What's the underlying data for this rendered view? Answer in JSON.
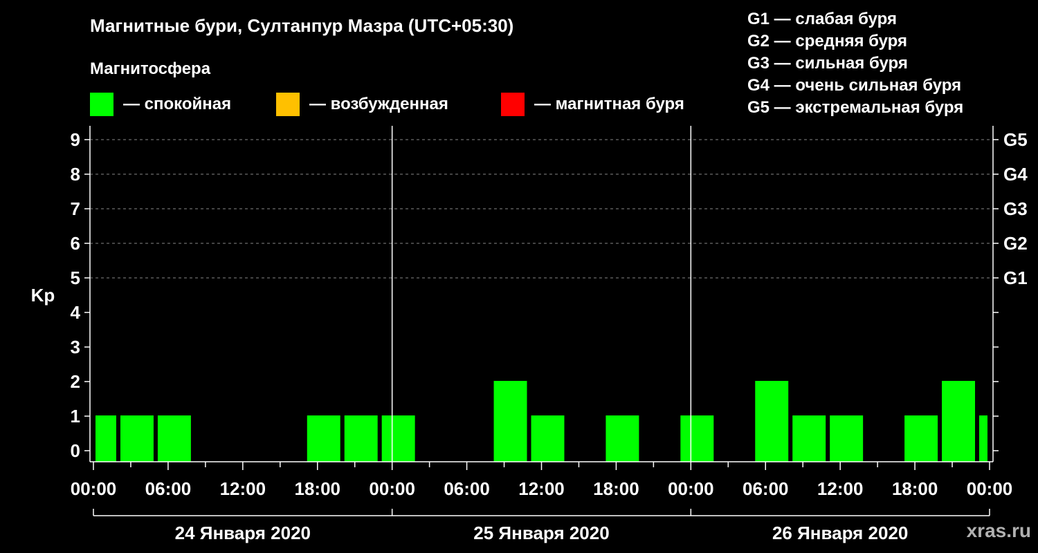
{
  "header": {
    "title": "Магнитные бури, Султанпур Мазра (UTC+05:30)",
    "magnetosphere_label": "Магнитосфера"
  },
  "legend": [
    {
      "label": "— спокойная",
      "color": "#00ff00"
    },
    {
      "label": "— возбужденная",
      "color": "#ffc000"
    },
    {
      "label": "— магнитная буря",
      "color": "#ff0000"
    }
  ],
  "g_scale": [
    "G1 — слабая буря",
    "G2 — средняя буря",
    "G3 — сильная буря",
    "G4 — очень сильная буря",
    "G5 — экстремальная буря"
  ],
  "credit": "xras.ru",
  "chart_data": {
    "type": "bar",
    "ylabel": "Kp",
    "ylim": [
      0,
      9
    ],
    "y_ticks": [
      "0",
      "1",
      "2",
      "3",
      "4",
      "5",
      "6",
      "7",
      "8",
      "9"
    ],
    "g_levels": [
      {
        "label": "G1",
        "kp": 5
      },
      {
        "label": "G2",
        "kp": 6
      },
      {
        "label": "G3",
        "kp": 7
      },
      {
        "label": "G4",
        "kp": 8
      },
      {
        "label": "G5",
        "kp": 9
      }
    ],
    "x_ticks": [
      "00:00",
      "06:00",
      "12:00",
      "18:00",
      "00:00",
      "06:00",
      "12:00",
      "18:00",
      "00:00",
      "06:00",
      "12:00",
      "18:00",
      "00:00"
    ],
    "days": [
      "24 Января 2020",
      "25 Января 2020",
      "26 Января 2020"
    ],
    "x_range_hours": [
      0,
      72
    ],
    "grid": "dashed horizontal at G levels",
    "bar_color": "#00ff00",
    "bars": [
      {
        "start_hour": 0,
        "end_hour": 2,
        "kp": 1
      },
      {
        "start_hour": 2,
        "end_hour": 5,
        "kp": 1
      },
      {
        "start_hour": 5,
        "end_hour": 8,
        "kp": 1
      },
      {
        "start_hour": 8,
        "end_hour": 11,
        "kp": 0
      },
      {
        "start_hour": 11,
        "end_hour": 14,
        "kp": 0
      },
      {
        "start_hour": 14,
        "end_hour": 17,
        "kp": 0
      },
      {
        "start_hour": 17,
        "end_hour": 20,
        "kp": 1
      },
      {
        "start_hour": 20,
        "end_hour": 23,
        "kp": 1
      },
      {
        "start_hour": 23,
        "end_hour": 26,
        "kp": 1
      },
      {
        "start_hour": 26,
        "end_hour": 29,
        "kp": 0
      },
      {
        "start_hour": 29,
        "end_hour": 32,
        "kp": 0
      },
      {
        "start_hour": 32,
        "end_hour": 35,
        "kp": 2
      },
      {
        "start_hour": 35,
        "end_hour": 38,
        "kp": 1
      },
      {
        "start_hour": 38,
        "end_hour": 41,
        "kp": 0
      },
      {
        "start_hour": 41,
        "end_hour": 44,
        "kp": 1
      },
      {
        "start_hour": 44,
        "end_hour": 47,
        "kp": 0
      },
      {
        "start_hour": 47,
        "end_hour": 50,
        "kp": 1
      },
      {
        "start_hour": 50,
        "end_hour": 53,
        "kp": 0
      },
      {
        "start_hour": 53,
        "end_hour": 56,
        "kp": 2
      },
      {
        "start_hour": 56,
        "end_hour": 59,
        "kp": 1
      },
      {
        "start_hour": 59,
        "end_hour": 62,
        "kp": 1
      },
      {
        "start_hour": 62,
        "end_hour": 65,
        "kp": 0
      },
      {
        "start_hour": 65,
        "end_hour": 68,
        "kp": 1
      },
      {
        "start_hour": 68,
        "end_hour": 71,
        "kp": 2
      },
      {
        "start_hour": 71,
        "end_hour": 72,
        "kp": 1
      }
    ]
  }
}
